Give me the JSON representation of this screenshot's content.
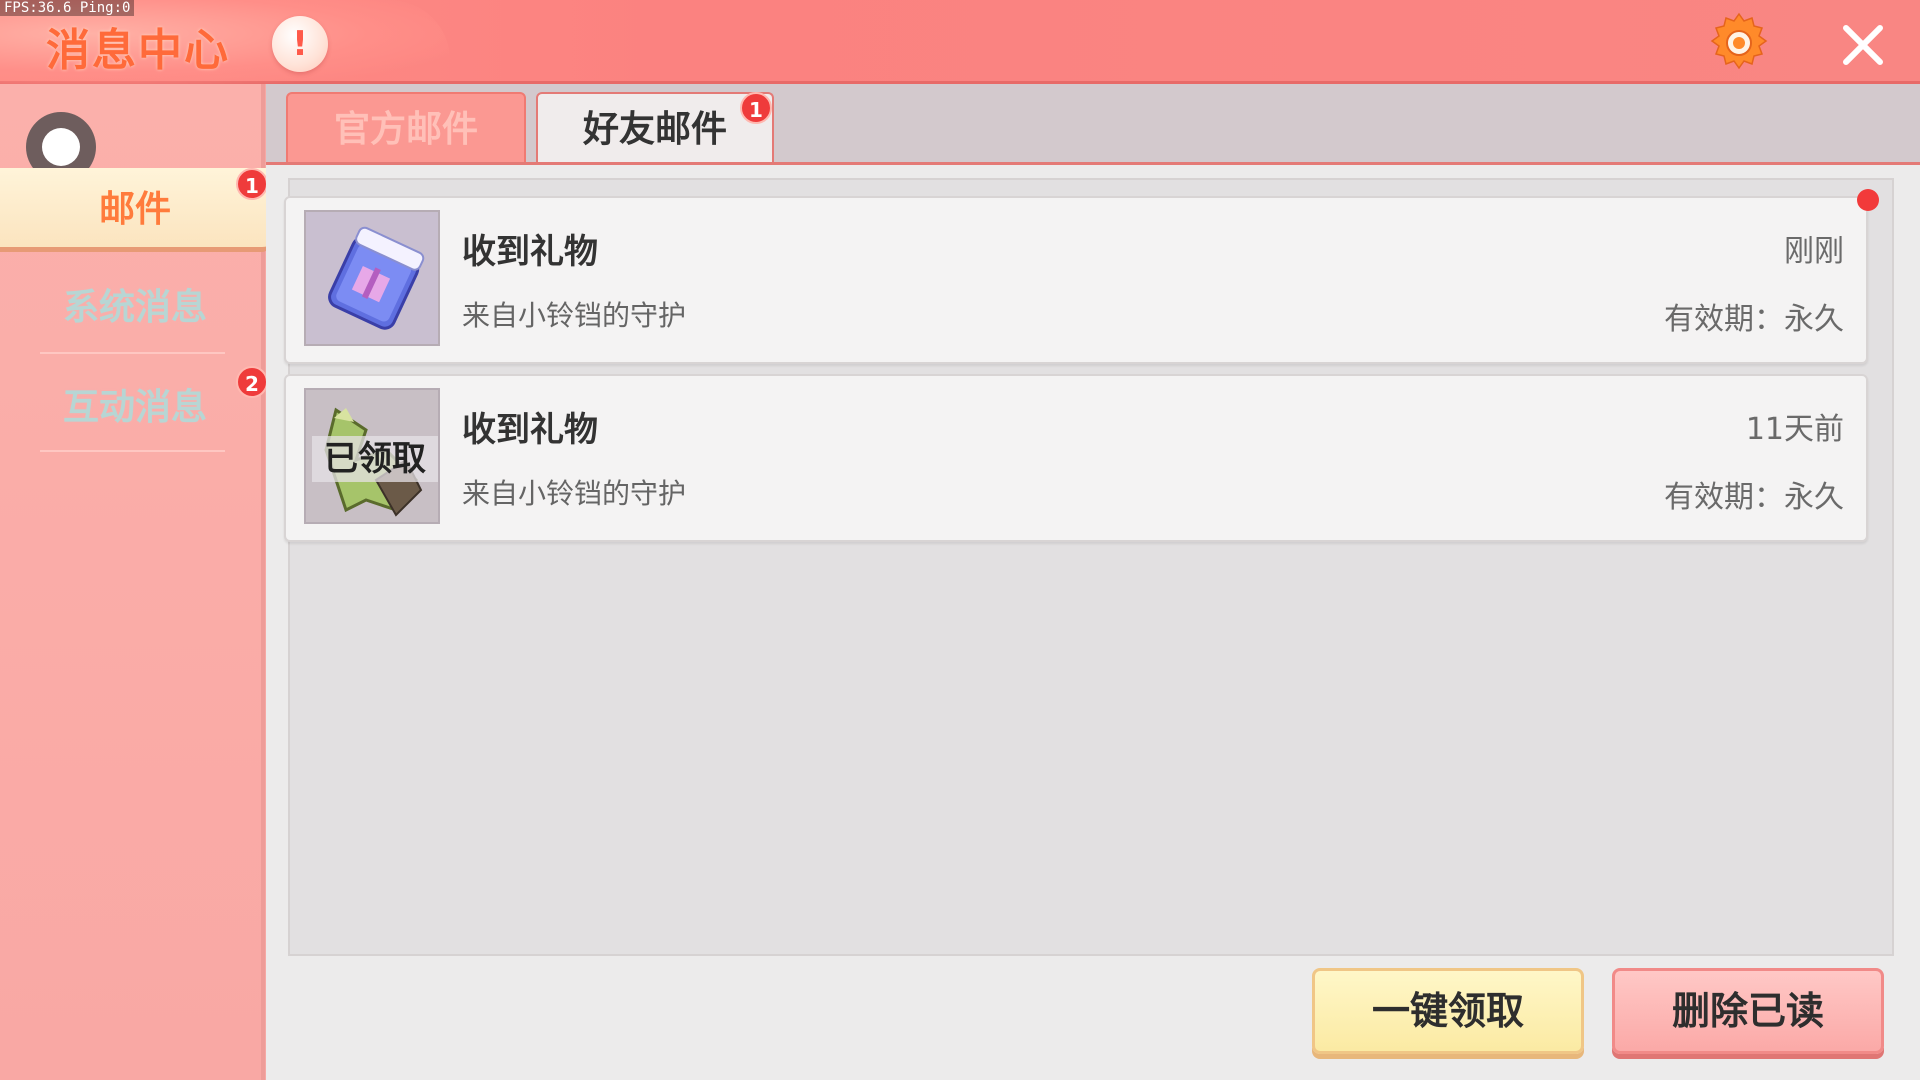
{
  "status": {
    "fps_text": "FPS:36.6  Ping:0"
  },
  "header": {
    "title": "消息中心",
    "alert_symbol": "!"
  },
  "sidebar": {
    "items": [
      {
        "label": "邮件",
        "badge": "1",
        "active": true
      },
      {
        "label": "系统消息",
        "badge": "",
        "active": false
      },
      {
        "label": "互动消息",
        "badge": "2",
        "active": false
      }
    ]
  },
  "tabs": [
    {
      "label": "官方邮件",
      "badge": "",
      "active": false
    },
    {
      "label": "好友邮件",
      "badge": "1",
      "active": true
    }
  ],
  "mails": [
    {
      "title": "收到礼物",
      "from": "来自小铃铛的守护",
      "time": "刚刚",
      "validity": "有效期：永久",
      "claimed": false,
      "unread": true,
      "icon": "gift-box-icon"
    },
    {
      "title": "收到礼物",
      "from": "来自小铃铛的守护",
      "time": "11天前",
      "validity": "有效期：永久",
      "claimed": true,
      "claimed_label": "已领取",
      "unread": false,
      "icon": "green-plant-item-icon"
    }
  ],
  "footer": {
    "claim_all_label": "一键领取",
    "delete_read_label": "删除已读"
  },
  "colors": {
    "header_bg": "#fb8280",
    "sidebar_bg": "#f9a8a4",
    "badge_red": "#ef3b3b",
    "title_orange": "#ff6a3a",
    "active_tab_text": "#333333"
  }
}
